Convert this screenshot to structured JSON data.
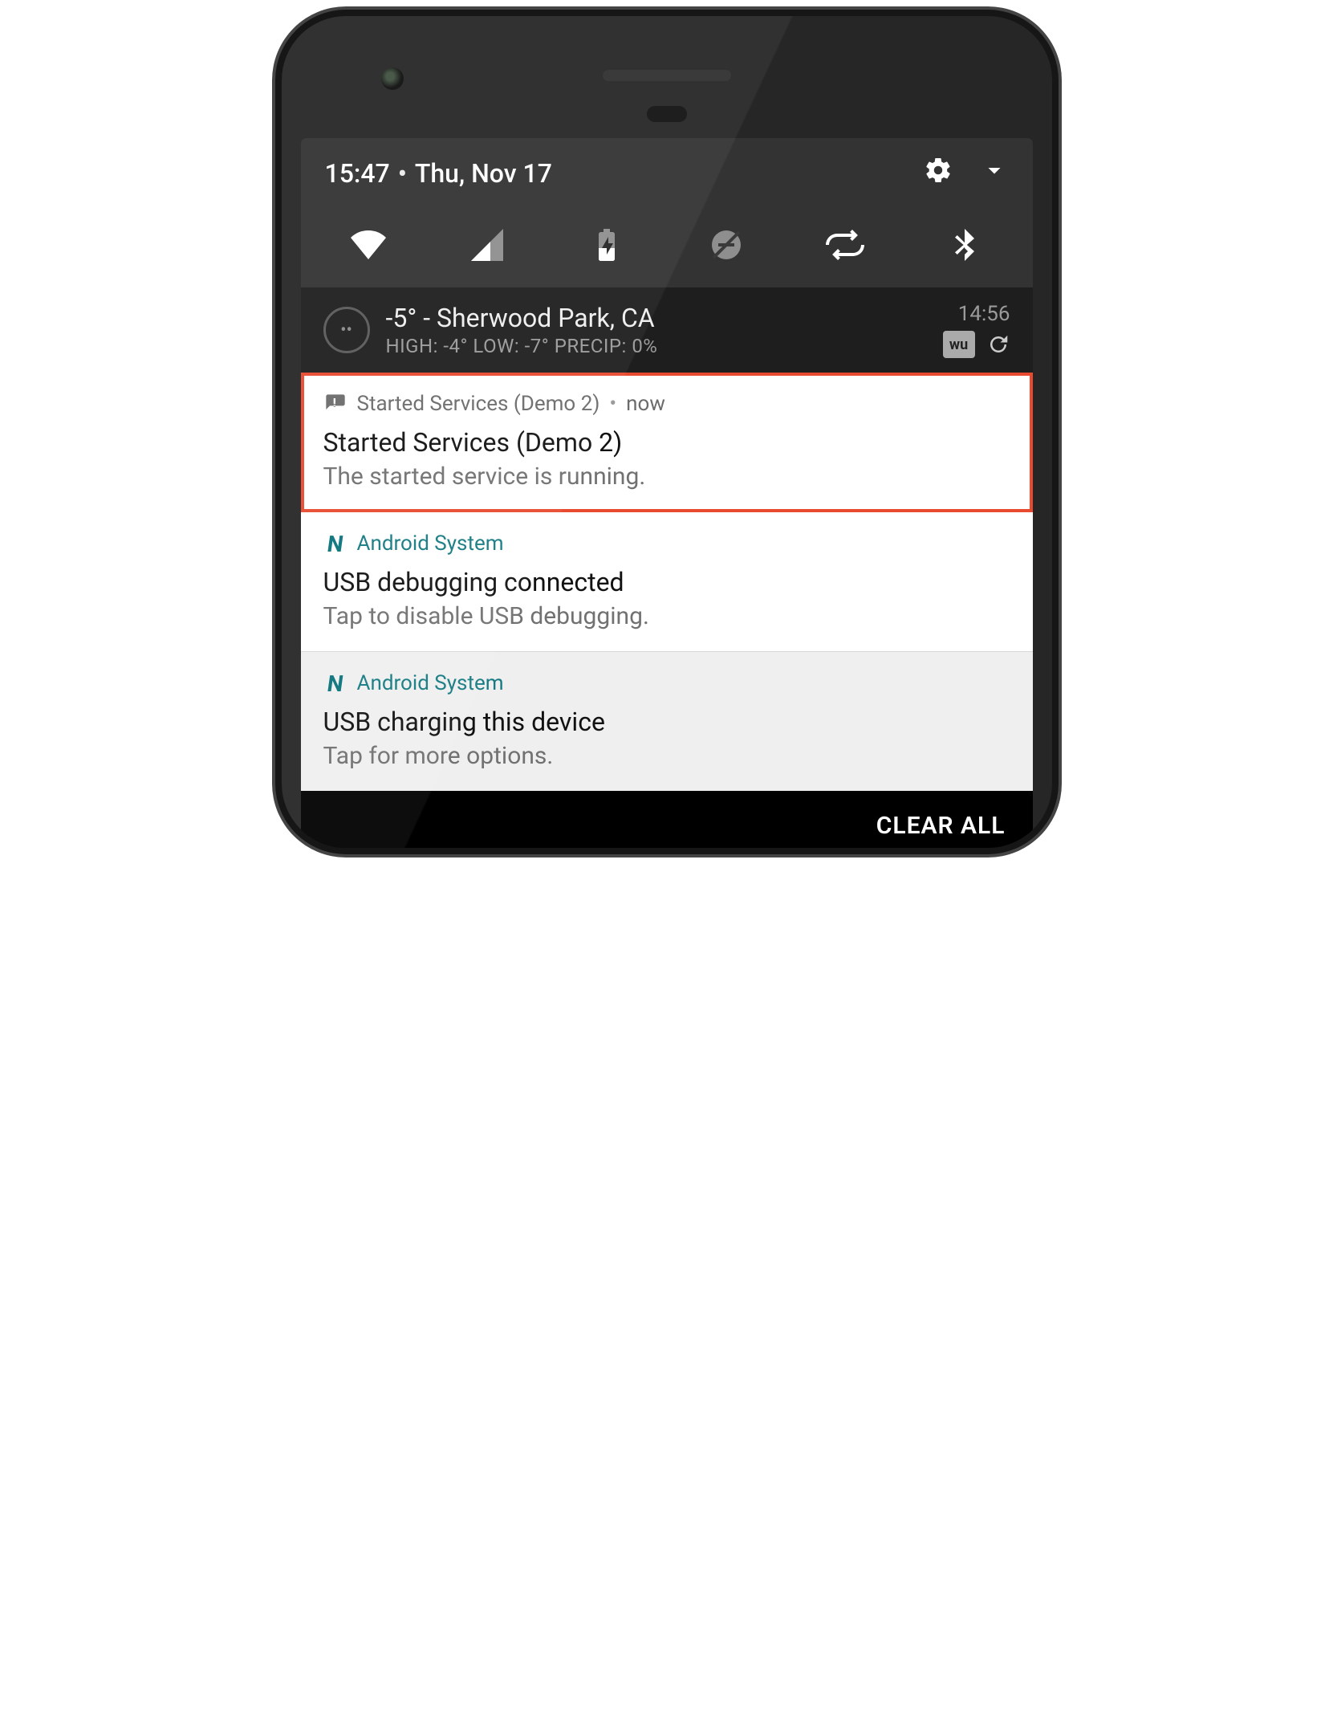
{
  "quick_settings": {
    "time": "15:47",
    "date": "Thu, Nov 17"
  },
  "weather": {
    "line1": "-5° - Sherwood Park, CA",
    "line2": "HIGH: -4° LOW: -7° PRECIP: 0%",
    "time": "14:56",
    "badge": "wu"
  },
  "notifications": [
    {
      "app": "Started Services (Demo 2)",
      "when": "now",
      "title": "Started Services (Demo 2)",
      "body": "The started service is running."
    },
    {
      "app": "Android System",
      "title": "USB debugging connected",
      "body": "Tap to disable USB debugging."
    },
    {
      "app": "Android System",
      "title": "USB charging this device",
      "body": "Tap for more options."
    }
  ],
  "clear_all_label": "CLEAR ALL"
}
